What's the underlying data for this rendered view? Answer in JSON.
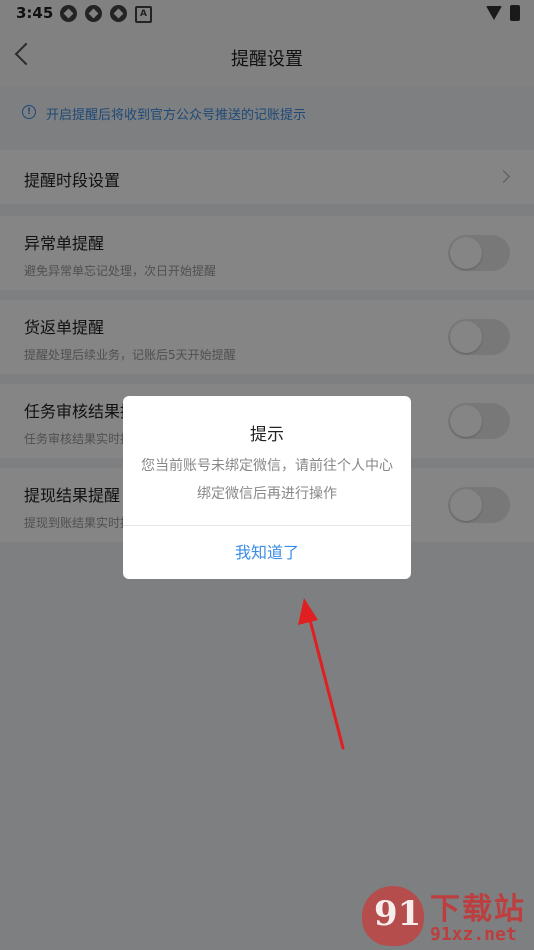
{
  "status_bar": {
    "time": "3:45",
    "badge_letter": "A"
  },
  "nav": {
    "title": "提醒设置"
  },
  "notice": {
    "text": "开启提醒后将收到官方公众号推送的记账提示"
  },
  "period_setting": {
    "label": "提醒时段设置"
  },
  "settings": [
    {
      "title": "异常单提醒",
      "subtitle": "避免异常单忘记处理，次日开始提醒",
      "enabled": false
    },
    {
      "title": "货返单提醒",
      "subtitle": "提醒处理后续业务，记账后5天开始提醒",
      "enabled": false
    },
    {
      "title": "任务审核结果提醒",
      "subtitle": "任务审核结果实时提醒",
      "enabled": false
    },
    {
      "title": "提现结果提醒",
      "subtitle": "提现到账结果实时提醒",
      "enabled": false
    }
  ],
  "dialog": {
    "title": "提示",
    "message": "您当前账号未绑定微信，请前往个人中心绑定微信后再进行操作",
    "confirm_label": "我知道了"
  },
  "watermark": {
    "brand": "下载站",
    "url": "91xz.net",
    "logo_text": "91"
  },
  "colors": {
    "accent": "#3a8ee6",
    "annotation_arrow": "#e02020"
  }
}
